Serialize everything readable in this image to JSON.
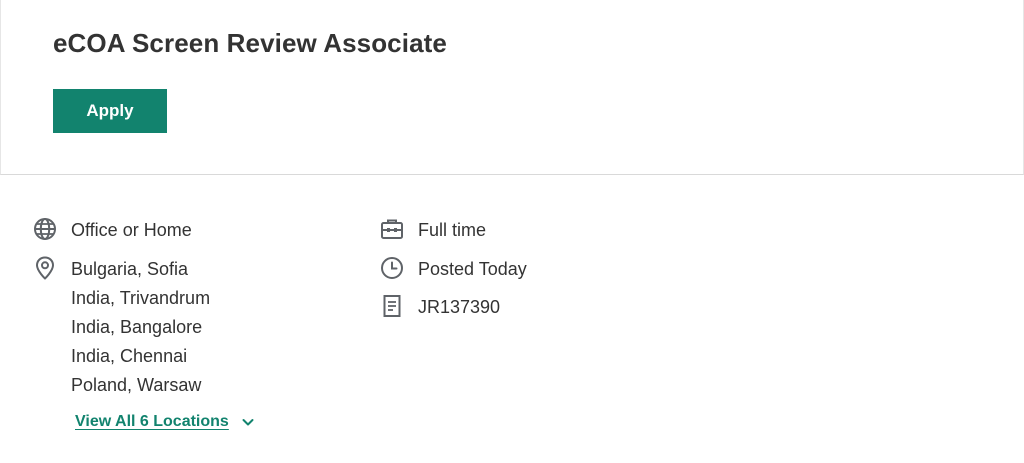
{
  "job": {
    "title": "eCOA Screen Review Associate",
    "apply_label": "Apply"
  },
  "details": {
    "work_mode": "Office or Home",
    "locations": [
      "Bulgaria, Sofia",
      "India, Trivandrum",
      "India, Bangalore",
      "India, Chennai",
      "Poland, Warsaw"
    ],
    "view_all_label": "View All 6 Locations",
    "employment_type": "Full time",
    "posted": "Posted Today",
    "job_id": "JR137390"
  },
  "icons": {
    "work_mode": "globe-icon",
    "locations": "map-pin-icon",
    "employment_type": "briefcase-icon",
    "posted": "clock-icon",
    "job_id": "document-icon",
    "view_all": "chevron-down-icon"
  },
  "colors": {
    "accent": "#12836e",
    "text": "#333333",
    "icon": "#5f6368",
    "divider": "#d9d9d9"
  }
}
